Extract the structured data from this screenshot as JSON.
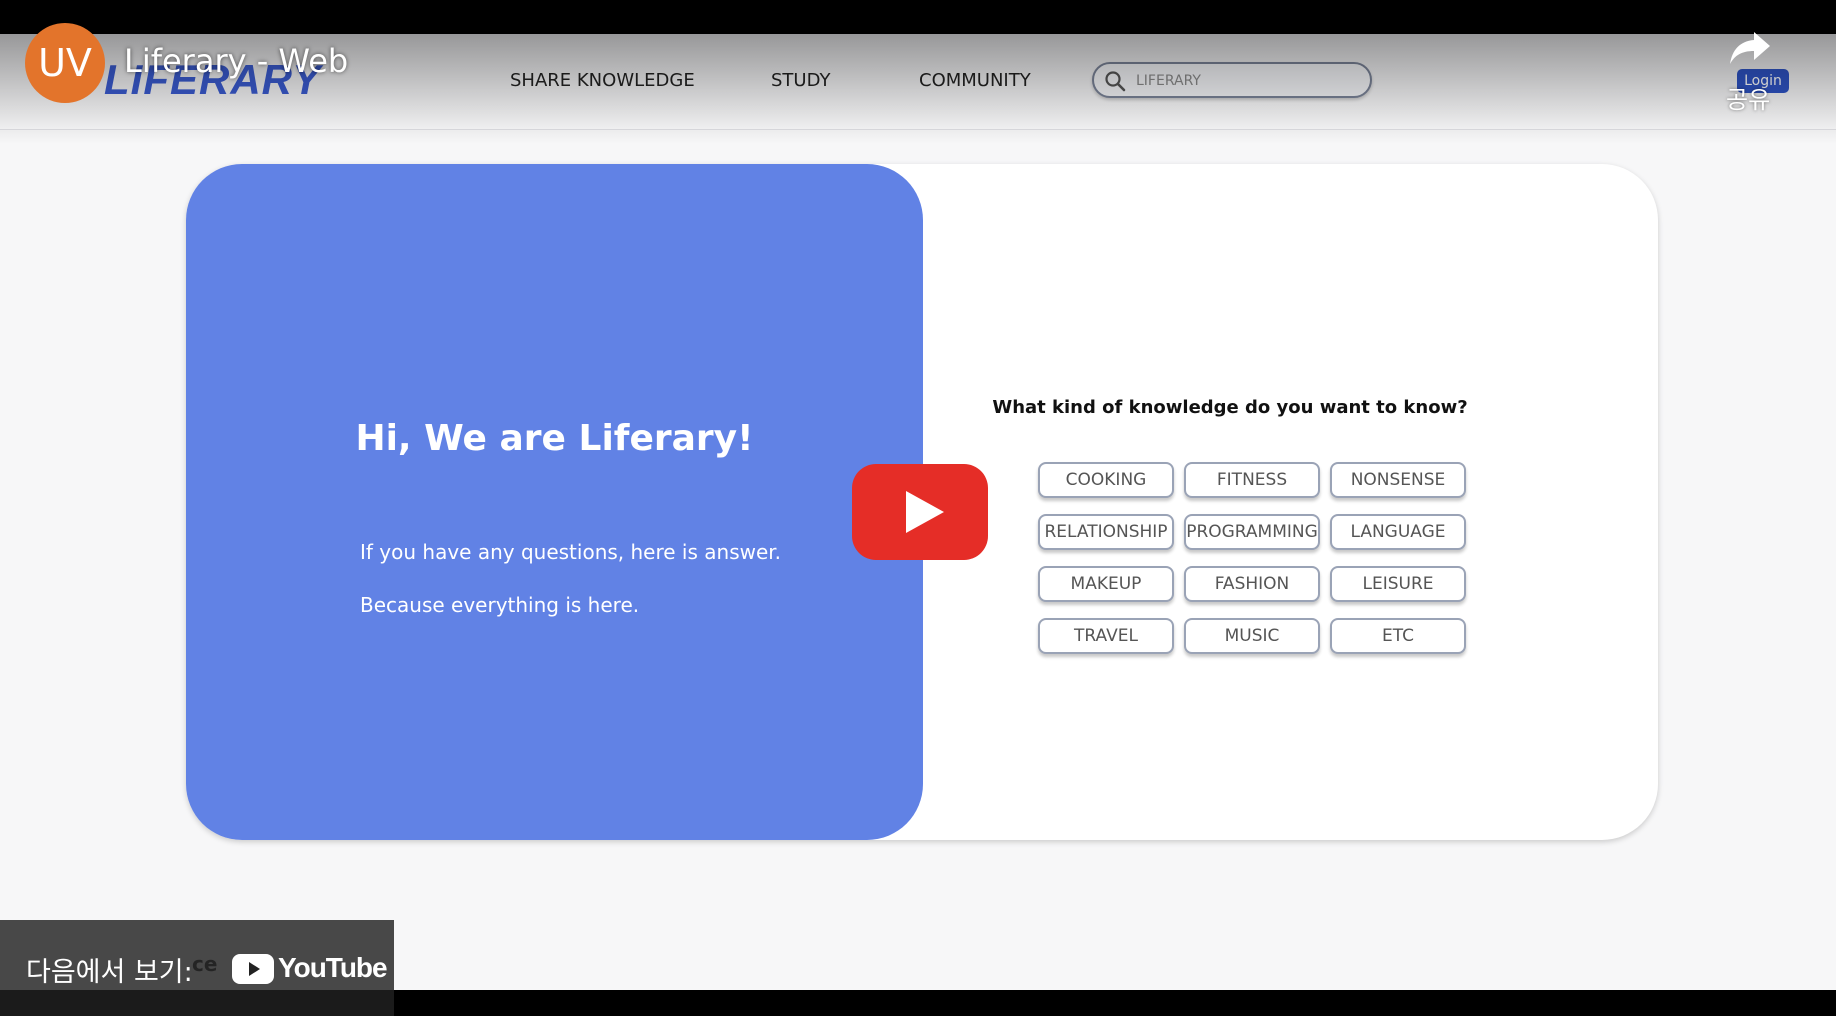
{
  "video": {
    "title": "Liferary - Web",
    "channel_avatar_text": "UV",
    "share_label": "공유",
    "watch_on_label": "다음에서 보기:",
    "youtube_brand": "YouTube",
    "play_icon": "play-icon",
    "colors": {
      "play_red": "#e52d27",
      "avatar_orange": "#e3742b"
    }
  },
  "site": {
    "logo": "LIFERARY",
    "nav": {
      "share_knowledge": "SHARE KNOWLEDGE",
      "study": "STUDY",
      "community": "COMMUNITY"
    },
    "search": {
      "placeholder": "LIFERARY"
    },
    "login_label": "Login",
    "colors": {
      "brand_blue": "#6182e5",
      "logo_blue": "#3a5bd0"
    }
  },
  "hero": {
    "title": "Hi, We are Liferary!",
    "line1": "If you have any questions, here is answer.",
    "line2": "Because everything is here.",
    "question": "What kind of knowledge do you want to know?",
    "tags": [
      "COOKING",
      "FITNESS",
      "NONSENSE",
      "RELATIONSHIP",
      "PROGRAMMING",
      "LANGUAGE",
      "MAKEUP",
      "FASHION",
      "LEISURE",
      "TRAVEL",
      "MUSIC",
      "ETC"
    ]
  },
  "below_fold_text": "ce"
}
